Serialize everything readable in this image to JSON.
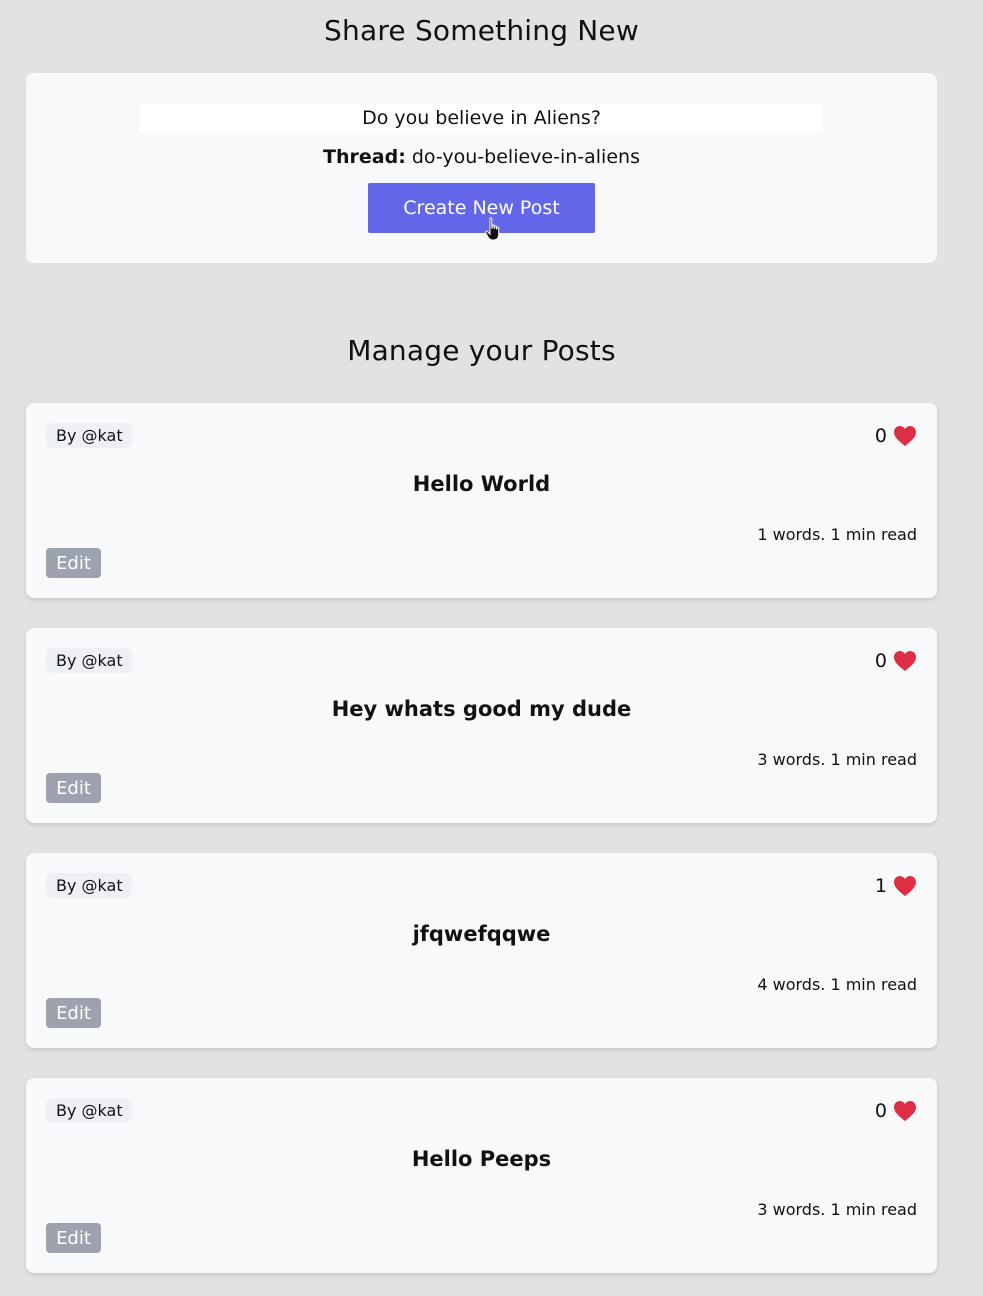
{
  "share": {
    "heading": "Share Something New",
    "title_value": "Do you believe in Aliens?",
    "thread_label": "Thread:",
    "thread_slug": "do-you-believe-in-aliens",
    "create_button": "Create New Post",
    "accent_color": "#6366e8"
  },
  "manage": {
    "heading": "Manage your Posts",
    "edit_label": "Edit",
    "posts": [
      {
        "author": "By @kat",
        "likes": "0",
        "title": "Hello World",
        "reading": "1 words. 1 min read"
      },
      {
        "author": "By @kat",
        "likes": "0",
        "title": "Hey whats good my dude",
        "reading": "3 words. 1 min read"
      },
      {
        "author": "By @kat",
        "likes": "1",
        "title": "jfqwefqqwe",
        "reading": "4 words. 1 min read"
      },
      {
        "author": "By @kat",
        "likes": "0",
        "title": "Hello Peeps",
        "reading": "3 words. 1 min read"
      }
    ]
  },
  "icons": {
    "like": "heart-icon",
    "pointer": "hand-cursor-icon"
  }
}
